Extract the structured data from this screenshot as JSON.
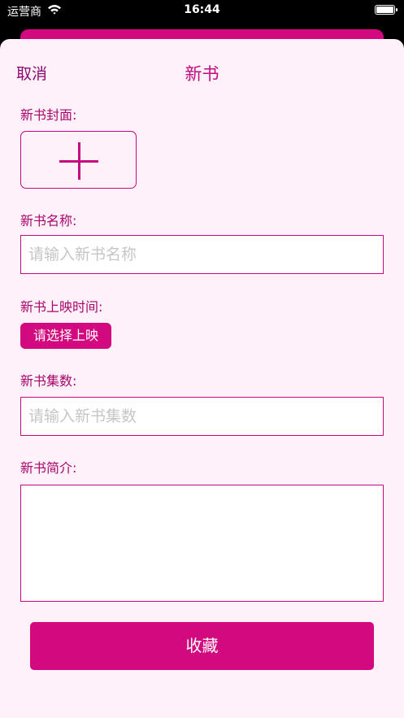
{
  "status_bar": {
    "carrier": "运营商",
    "time": "16:44"
  },
  "header": {
    "cancel_label": "取消",
    "title": "新书"
  },
  "form": {
    "cover_label": "新书封面:",
    "name_label": "新书名称:",
    "name_placeholder": "请输入新书名称",
    "name_value": "",
    "release_label": "新书上映时间:",
    "release_button": "请选择上映",
    "episodes_label": "新书集数:",
    "episodes_placeholder": "请输入新书集数",
    "episodes_value": "",
    "intro_label": "新书简介:",
    "intro_value": ""
  },
  "submit_label": "收藏",
  "colors": {
    "accent": "#d2097f",
    "sheet_bg": "#fef1f9"
  }
}
